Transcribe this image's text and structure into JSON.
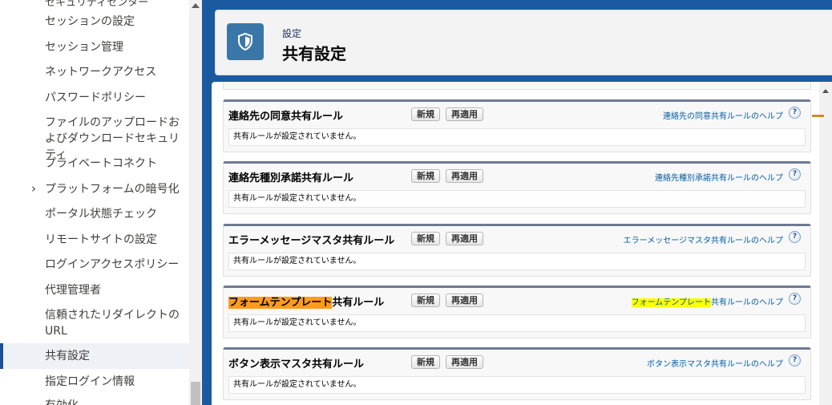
{
  "sidebar": {
    "top_clipped": "セキュリティセンター",
    "items": [
      {
        "label": "セッションの設定"
      },
      {
        "label": "セッション管理"
      },
      {
        "label": "ネットワークアクセス"
      },
      {
        "label": "パスワードポリシー"
      },
      {
        "label": "ファイルのアップロードおよびダウンロードセキュリティ"
      },
      {
        "label": "プライベートコネクト"
      },
      {
        "label": "プラットフォームの暗号化",
        "expandable": true
      },
      {
        "label": "ポータル状態チェック"
      },
      {
        "label": "リモートサイトの設定"
      },
      {
        "label": "ログインアクセスポリシー"
      },
      {
        "label": "代理管理者"
      },
      {
        "label": "信頼されたリダイレクトのURL"
      },
      {
        "label": "共有設定",
        "active": true
      },
      {
        "label": "指定ログイン情報"
      },
      {
        "label": "有効化"
      }
    ],
    "chevron_icon": "chevron-right-icon"
  },
  "header": {
    "eyebrow": "設定",
    "title": "共有設定",
    "icon": "shield-icon",
    "icon_color": "#3a77a8"
  },
  "sections": [
    {
      "title": "連絡先の同意共有ルール",
      "new_label": "新規",
      "reapply_label": "再適用",
      "help_link": "連絡先の同意共有ルールのヘルプ",
      "body": "共有ルールが設定されていません。"
    },
    {
      "title": "連絡先種別承諾共有ルール",
      "new_label": "新規",
      "reapply_label": "再適用",
      "help_link": "連絡先種別承諾共有ルールのヘルプ",
      "body": "共有ルールが設定されていません。"
    },
    {
      "title": "エラーメッセージマスタ共有ルール",
      "new_label": "新規",
      "reapply_label": "再適用",
      "help_link": "エラーメッセージマスタ共有ルールのヘルプ",
      "body": "共有ルールが設定されていません。"
    },
    {
      "title_highlight": "フォームテンプレート",
      "title_rest": "共有ルール",
      "new_label": "新規",
      "reapply_label": "再適用",
      "help_highlight": "フォームテンプレート",
      "help_rest": "共有ルールのヘルプ",
      "body": "共有ルールが設定されていません。"
    },
    {
      "title": "ボタン表示マスタ共有ルール",
      "new_label": "新規",
      "reapply_label": "再適用",
      "help_link": "ボタン表示マスタ共有ルールのヘルプ",
      "body": "共有ルールが設定されていません。"
    }
  ],
  "help_icon_glyph": "?",
  "colors": {
    "brand_blue": "#1b5aa0",
    "section_border": "#6e7a94",
    "highlight_orange": "#ff9a1f",
    "highlight_yellow": "#ffff00",
    "link": "#015ba7"
  }
}
